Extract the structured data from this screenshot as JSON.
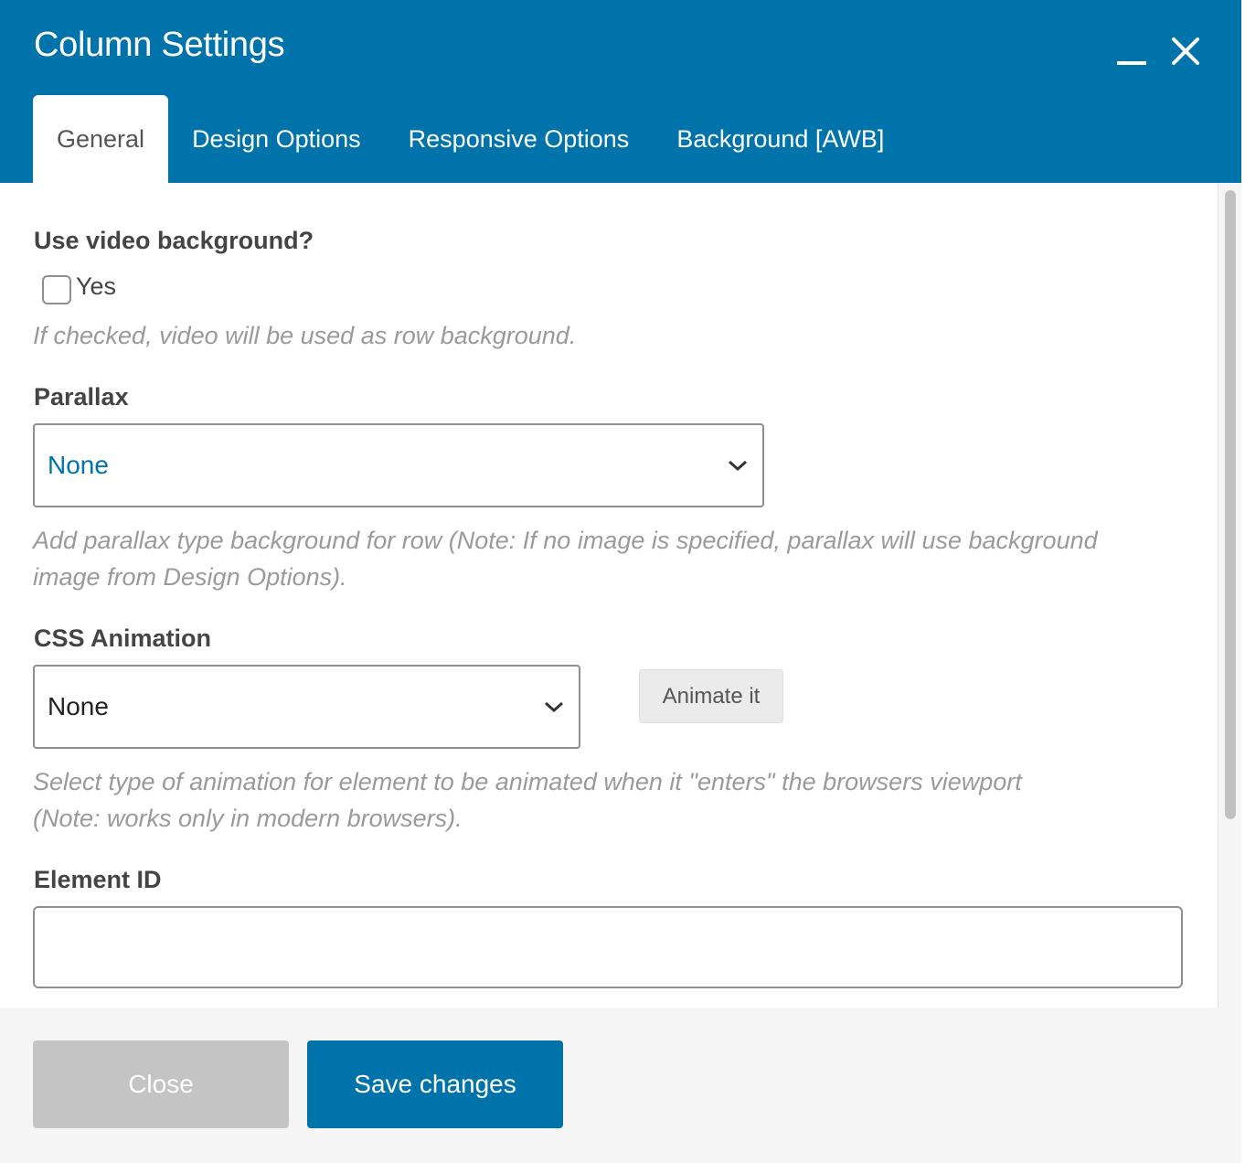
{
  "window": {
    "title": "Column Settings",
    "minimize_icon": "minimize-icon",
    "close_icon": "close-icon"
  },
  "tabs": [
    {
      "label": "General",
      "active": true
    },
    {
      "label": "Design Options",
      "active": false
    },
    {
      "label": "Responsive Options",
      "active": false
    },
    {
      "label": "Background [AWB]",
      "active": false
    }
  ],
  "form": {
    "video_bg": {
      "label": "Use video background?",
      "checkbox_label": "Yes",
      "checked": false,
      "help": "If checked, video will be used as row background."
    },
    "parallax": {
      "label": "Parallax",
      "value": "None",
      "help_line1": "Add parallax type background for row (Note: If no image is specified, parallax will use background",
      "help_line2": "image from Design Options)."
    },
    "css_animation": {
      "label": "CSS Animation",
      "value": "None",
      "button_label": "Animate it",
      "help_line1": "Select type of animation for element to be animated when it \"enters\" the browsers viewport",
      "help_line2": "(Note: works only in modern browsers)."
    },
    "element_id": {
      "label": "Element ID",
      "value": ""
    }
  },
  "footer": {
    "close_label": "Close",
    "save_label": "Save changes"
  },
  "colors": {
    "brand": "#0073aa",
    "select_accent": "#0073aa"
  }
}
